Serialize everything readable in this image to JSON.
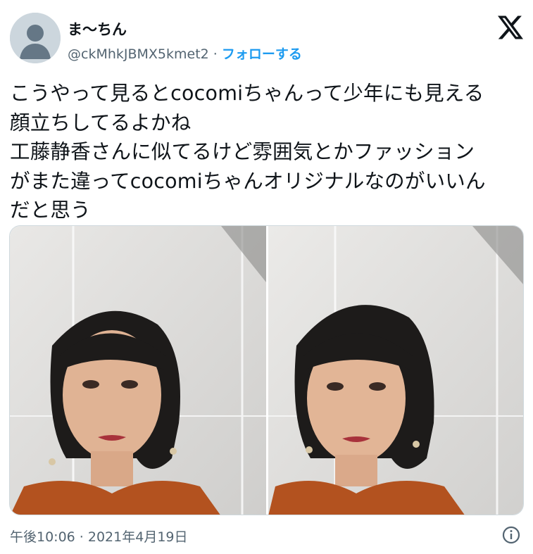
{
  "user": {
    "display_name": "ま〜ちん",
    "handle": "@ckMhkJBMX5kmet2",
    "separator": "·",
    "follow_label": "フォローする",
    "avatar_icon": "default-avatar-icon"
  },
  "brand": {
    "logo_icon": "x-logo-icon"
  },
  "tweet": {
    "lines": [
      "こうやって見るとcocomiちゃんって少年にも見える",
      "顔立ちしてるよかね",
      "工藤静香さんに似てるけど雰囲気とかファッション",
      "がまた違ってcocomiちゃんオリジナルなのがいいん",
      "だと思う"
    ]
  },
  "media": {
    "count": 2,
    "items": [
      {
        "icon": "photo-portrait-icon"
      },
      {
        "icon": "photo-portrait-icon"
      }
    ]
  },
  "meta": {
    "timestamp": "午後10:06 · 2021年4月19日",
    "info_icon": "info-icon"
  },
  "colors": {
    "text": "#0f1419",
    "secondary": "#536471",
    "accent": "#1d9bf0",
    "avatar_bg": "#ccd6dd"
  }
}
